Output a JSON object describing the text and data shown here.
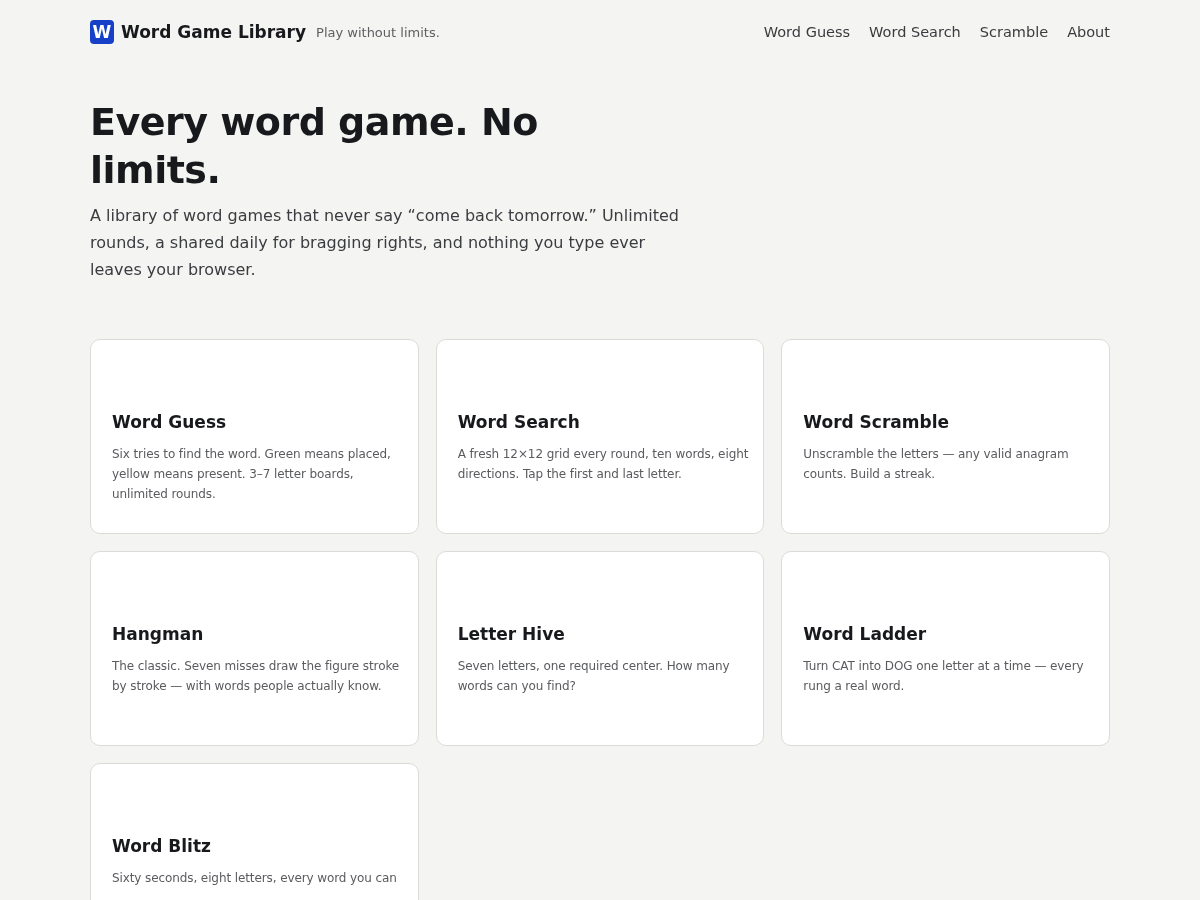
{
  "brand": {
    "logo_letter": "W",
    "name": "Word Game Library",
    "tagline": "Play without limits."
  },
  "nav": [
    {
      "label": "Word Guess"
    },
    {
      "label": "Word Search"
    },
    {
      "label": "Scramble"
    },
    {
      "label": "About"
    }
  ],
  "hero": {
    "title": "Every word game. No limits.",
    "text": "A library of word games that never say “come back tomorrow.” Unlimited rounds, a shared daily for bragging rights, and nothing you type ever leaves your browser."
  },
  "games": [
    {
      "title": "Word Guess",
      "description": "Six tries to find the word. Green means placed, yellow means present. 3–7 letter boards, unlimited rounds."
    },
    {
      "title": "Word Search",
      "description": "A fresh 12×12 grid every round, ten words, eight directions. Tap the first and last letter."
    },
    {
      "title": "Word Scramble",
      "description": "Unscramble the letters — any valid anagram counts. Build a streak."
    },
    {
      "title": "Hangman",
      "description": "The classic. Seven misses draw the figure stroke by stroke — with words people actually know."
    },
    {
      "title": "Letter Hive",
      "description": "Seven letters, one required center. How many words can you find?"
    },
    {
      "title": "Word Ladder",
      "description": "Turn CAT into DOG one letter at a time — every rung a real word."
    },
    {
      "title": "Word Blitz",
      "description": "Sixty seconds, eight letters, every word you can"
    }
  ]
}
